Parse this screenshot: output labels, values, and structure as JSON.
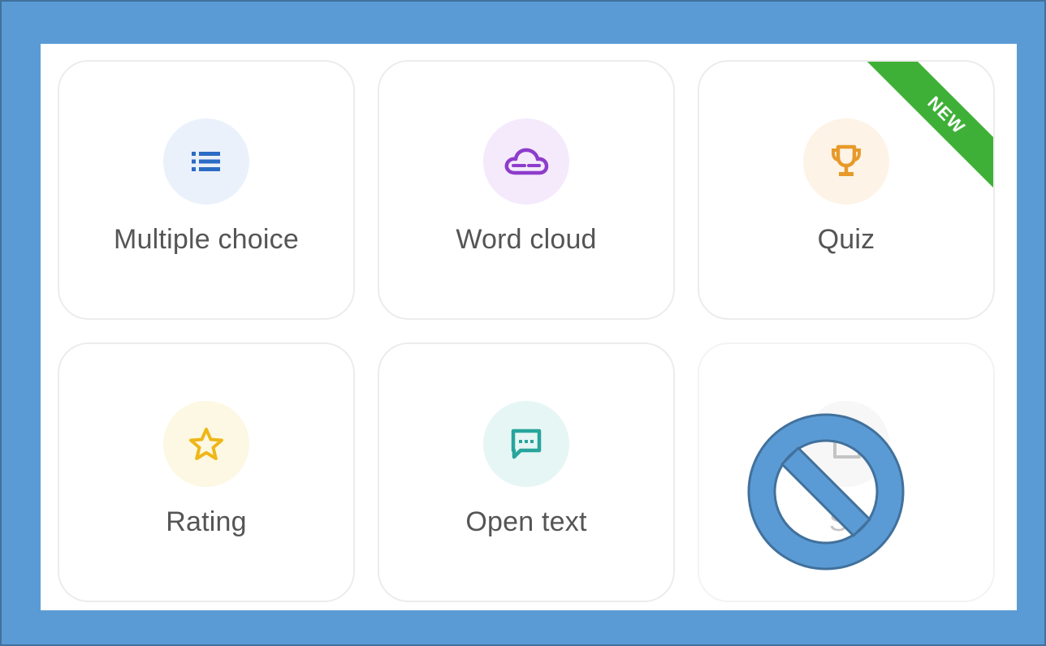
{
  "options": [
    {
      "label": "Multiple choice",
      "icon": "list-icon",
      "icon_color": "#2b6cc4",
      "icon_bg": "#eaf1fb"
    },
    {
      "label": "Word cloud",
      "icon": "cloud-icon",
      "icon_color": "#8e3ccb",
      "icon_bg": "#f4eafc"
    },
    {
      "label": "Quiz",
      "icon": "trophy-icon",
      "icon_color": "#e79a2a",
      "icon_bg": "#fdf3e6",
      "badge": "NEW"
    },
    {
      "label": "Rating",
      "icon": "star-icon",
      "icon_color": "#eeb718",
      "icon_bg": "#fdf8e3"
    },
    {
      "label": "Open text",
      "icon": "chat-icon",
      "icon_color": "#27a59c",
      "icon_bg": "#e6f6f5"
    },
    {
      "label": "Su",
      "icon": "document-icon",
      "icon_color": "#c4c4c4",
      "icon_bg": "#f7f7f7",
      "disabled": true
    }
  ],
  "overlay": {
    "icon": "prohibited-icon",
    "color": "#5b9bd5"
  },
  "colors": {
    "frame": "#5b9bd5",
    "badge": "#3fb037"
  }
}
